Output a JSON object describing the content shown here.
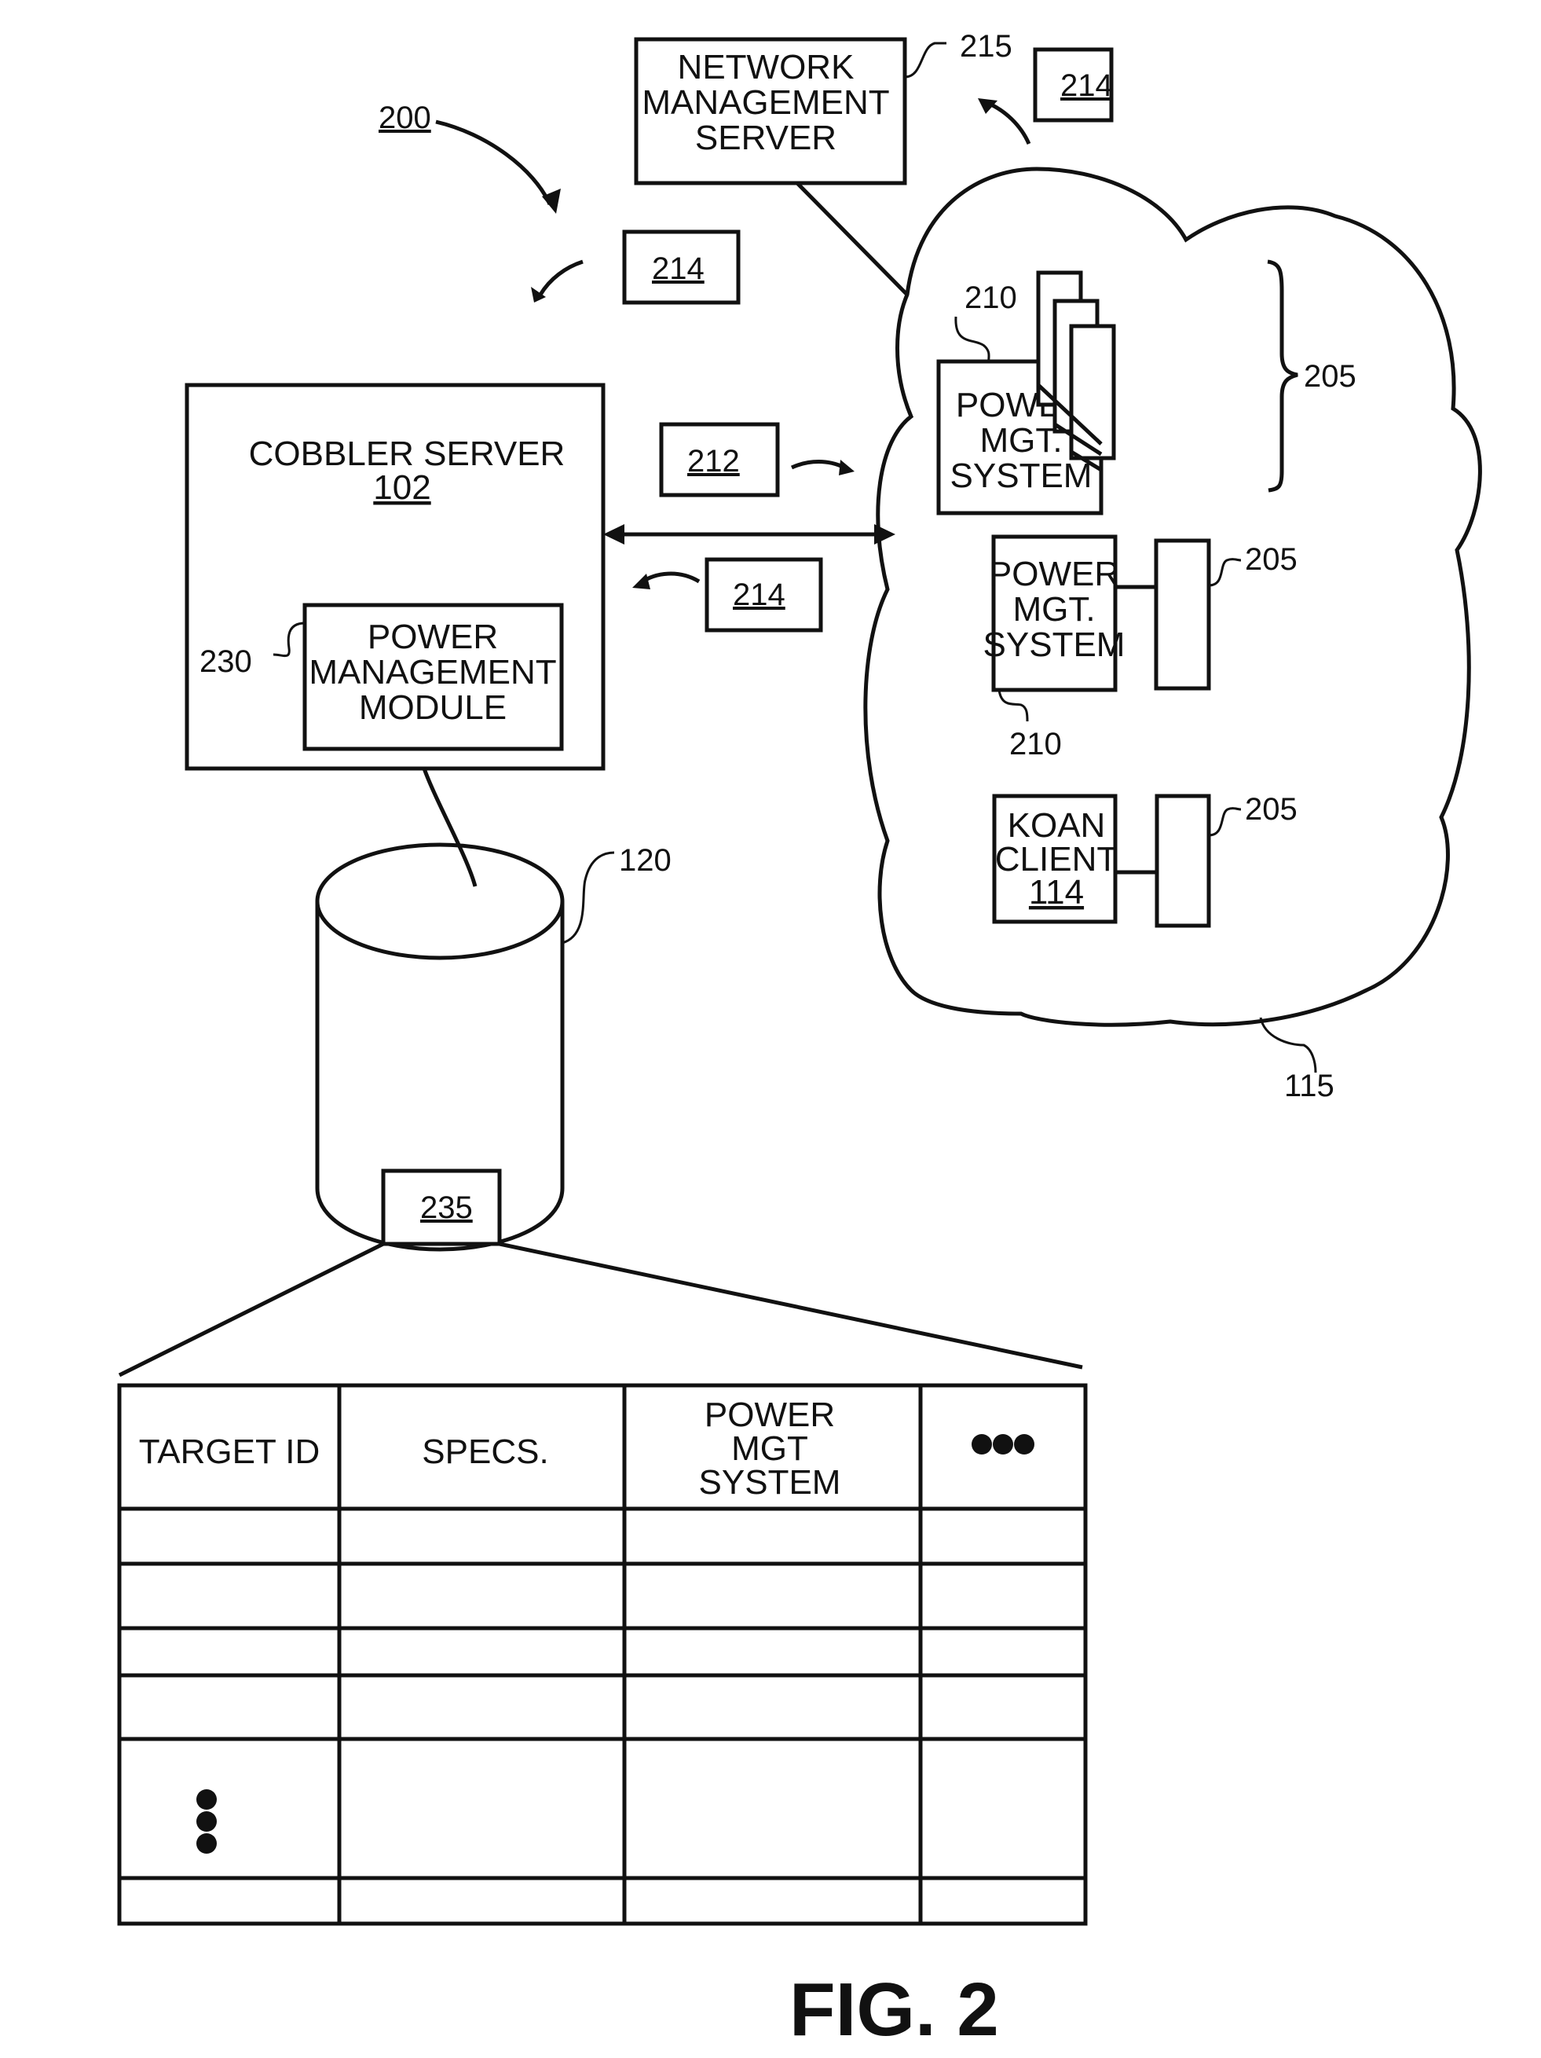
{
  "figure_label": "FIG. 2",
  "system_ref": "200",
  "network_management_server": {
    "lines": [
      "NETWORK",
      "MANAGEMENT",
      "SERVER"
    ],
    "ref": "215"
  },
  "messages": {
    "m212": "212",
    "m214_top_right": "214",
    "m214_top_left": "214",
    "m214_middle": "214"
  },
  "cobbler_server": {
    "title": "COBBLER SERVER",
    "ref": "102",
    "module": {
      "lines": [
        "POWER",
        "MANAGEMENT",
        "MODULE"
      ],
      "ref": "230"
    }
  },
  "network": {
    "ref": "115",
    "pms_top": {
      "lines": [
        "POWER",
        "MGT.",
        "SYSTEM"
      ],
      "ref": "210",
      "targets_ref": "205"
    },
    "pms_mid": {
      "lines": [
        "POWER",
        "MGT.",
        "SYSTEM"
      ],
      "ref": "210",
      "target_ref": "205"
    },
    "koan": {
      "lines": [
        "KOAN",
        "CLIENT"
      ],
      "ref": "114",
      "target_ref": "205"
    }
  },
  "database": {
    "ref": "120",
    "record_ref": "235"
  },
  "table": {
    "headers": [
      "TARGET ID",
      "SPECS.",
      "POWER MGT SYSTEM",
      "●●●"
    ],
    "header_power_lines": [
      "POWER",
      "MGT",
      "SYSTEM"
    ],
    "row_count": 6,
    "continuation": "⋮"
  }
}
